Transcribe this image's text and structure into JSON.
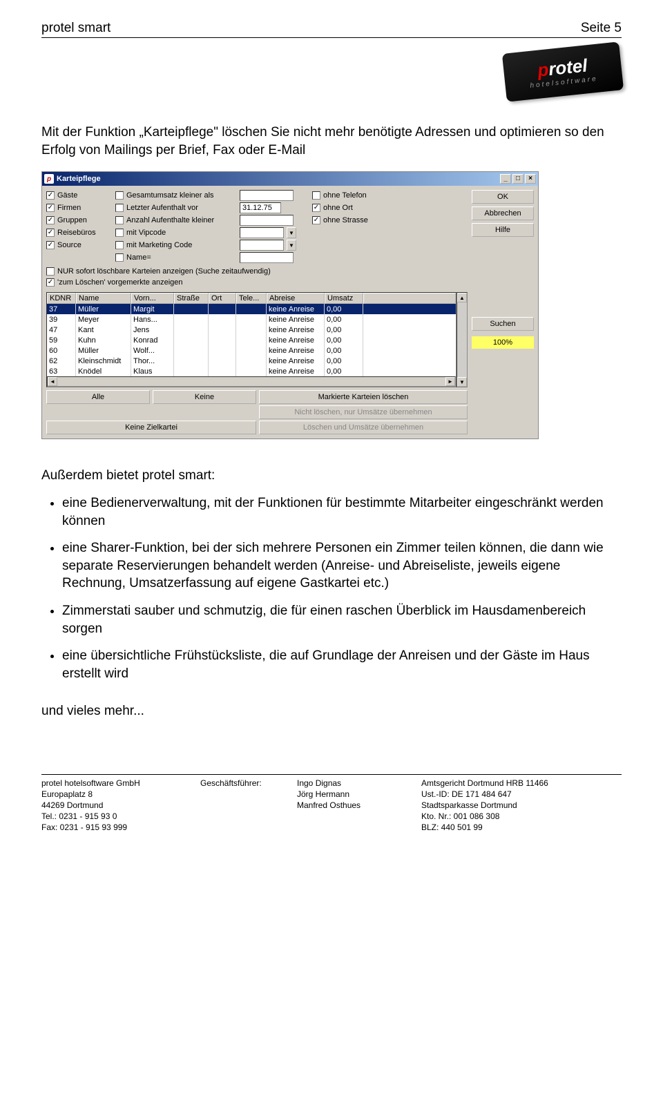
{
  "header": {
    "left": "protel smart",
    "right": "Seite 5"
  },
  "logo": {
    "brand_p": "p",
    "brand_rest": "rotel",
    "sub": "hotelsoftware"
  },
  "intro": "Mit der Funktion „Karteipflege\" löschen Sie nicht mehr benötigte Adressen und optimieren so den Erfolg von Mailings per Brief, Fax oder E-Mail",
  "window": {
    "title": "Karteipflege",
    "winbtns": {
      "min": "_",
      "max": "□",
      "close": "×"
    },
    "buttons": {
      "ok": "OK",
      "cancel": "Abbrechen",
      "help": "Hilfe",
      "search": "Suchen"
    },
    "progress": "100%",
    "filters": {
      "col1": [
        "Gäste",
        "Firmen",
        "Gruppen",
        "Reisebüros",
        "Source"
      ],
      "col1_checked": [
        true,
        true,
        true,
        true,
        true
      ],
      "col2": [
        "Gesamtumsatz kleiner als",
        "Letzter Aufenthalt vor",
        "Anzahl Aufenthalte kleiner",
        "mit Vipcode",
        "mit Marketing Code",
        "Name="
      ],
      "date_value": "31.12.75",
      "col4": [
        "ohne Telefon",
        "ohne Ort",
        "ohne Strasse"
      ],
      "col4_checked": [
        false,
        true,
        true
      ],
      "long1": "NUR sofort löschbare Karteien anzeigen (Suche zeitaufwendig)",
      "long2": "'zum Löschen' vorgemerkte anzeigen",
      "long2_checked": true
    },
    "table": {
      "cols": [
        "KDNR",
        "Name",
        "Vorn...",
        "Straße",
        "Ort",
        "Tele...",
        "Abreise",
        "Umsatz"
      ],
      "rows": [
        {
          "kd": "37",
          "name": "Müller",
          "vorn": "Margit",
          "str": "",
          "ort": "",
          "tel": "",
          "ab": "keine Anreise",
          "um": "0,00",
          "sel": true
        },
        {
          "kd": "39",
          "name": "Meyer",
          "vorn": "Hans...",
          "str": "",
          "ort": "",
          "tel": "",
          "ab": "keine Anreise",
          "um": "0,00"
        },
        {
          "kd": "47",
          "name": "Kant",
          "vorn": "Jens",
          "str": "",
          "ort": "",
          "tel": "",
          "ab": "keine Anreise",
          "um": "0,00"
        },
        {
          "kd": "59",
          "name": "Kuhn",
          "vorn": "Konrad",
          "str": "",
          "ort": "",
          "tel": "",
          "ab": "keine Anreise",
          "um": "0,00"
        },
        {
          "kd": "60",
          "name": "Müller",
          "vorn": "Wolf...",
          "str": "",
          "ort": "",
          "tel": "",
          "ab": "keine Anreise",
          "um": "0,00"
        },
        {
          "kd": "62",
          "name": "Kleinschmidt",
          "vorn": "Thor...",
          "str": "",
          "ort": "",
          "tel": "",
          "ab": "keine Anreise",
          "um": "0,00"
        },
        {
          "kd": "63",
          "name": "Knödel",
          "vorn": "Klaus",
          "str": "",
          "ort": "",
          "tel": "",
          "ab": "keine Anreise",
          "um": "0,00"
        }
      ]
    },
    "bottom": {
      "alle": "Alle",
      "keine": "Keine",
      "mark": "Markierte Karteien löschen",
      "nicht": "Nicht löschen, nur Umsätze übernehmen",
      "ziel": "Keine Zielkartei",
      "lub": "Löschen und Umsätze übernehmen"
    }
  },
  "intro2": "Außerdem bietet protel smart:",
  "bullets": [
    "eine Bedienerverwaltung, mit der Funktionen für bestimmte Mitarbeiter eingeschränkt werden können",
    "eine Sharer-Funktion, bei der sich mehrere Personen ein Zimmer teilen können, die dann wie separate Reservierungen behandelt werden (Anreise- und Abreiseliste, jeweils eigene Rechnung, Umsatzerfassung auf eigene Gastkartei etc.)",
    "Zimmerstati sauber und schmutzig, die für einen raschen Überblick im Hausdamenbereich sorgen",
    "eine übersichtliche Frühstücksliste, die auf Grundlage der Anreisen und der Gäste im Haus erstellt wird"
  ],
  "closing": "und vieles mehr...",
  "footer": {
    "c1": [
      "protel hotelsoftware GmbH",
      "Europaplatz 8",
      "44269 Dortmund",
      "Tel.: 0231 - 915 93 0",
      "Fax: 0231 - 915 93 999"
    ],
    "c2": [
      "Geschäftsführer:"
    ],
    "c3": [
      "Ingo Dignas",
      "Jörg Hermann",
      "Manfred Osthues"
    ],
    "c4": [
      "Amtsgericht Dortmund HRB 11466",
      "Ust.-ID: DE 171 484 647",
      "Stadtsparkasse Dortmund",
      "Kto. Nr.:    001 086 308",
      "BLZ:          440 501 99"
    ]
  }
}
